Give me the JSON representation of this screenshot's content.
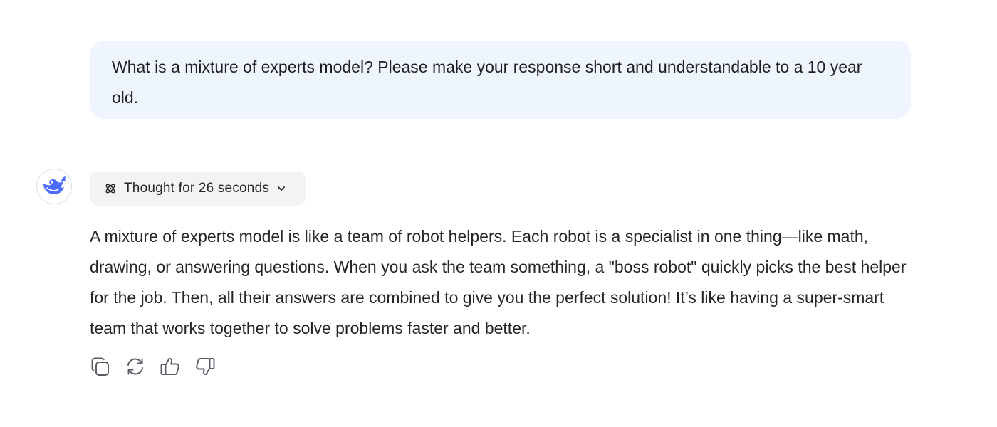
{
  "user_message": {
    "text": "What is a mixture of experts model? Please make your response short and understandable to a 10 year old."
  },
  "assistant": {
    "avatar_icon": "whale-logo-icon",
    "brand_color": "#4d6bfe",
    "thought": {
      "label": "Thought for 26 seconds",
      "icon": "atom-icon",
      "toggle_icon": "chevron-down-icon"
    },
    "answer_text": "A mixture of experts model is like a team of robot helpers. Each robot is a specialist in one thing—like math, drawing, or answering questions. When you ask the team something, a \"boss robot\" quickly picks the best helper for the job. Then, all their answers are combined to give you the perfect solution! It’s like having a super-smart team that works together to solve problems faster and better.",
    "actions": [
      {
        "name": "copy",
        "icon": "copy-icon"
      },
      {
        "name": "regenerate",
        "icon": "refresh-icon"
      },
      {
        "name": "like",
        "icon": "thumbs-up-icon"
      },
      {
        "name": "dislike",
        "icon": "thumbs-down-icon"
      }
    ]
  },
  "colors": {
    "user_bubble_bg": "#eef5ff",
    "chip_bg": "#f3f3f3",
    "text": "#262626"
  }
}
